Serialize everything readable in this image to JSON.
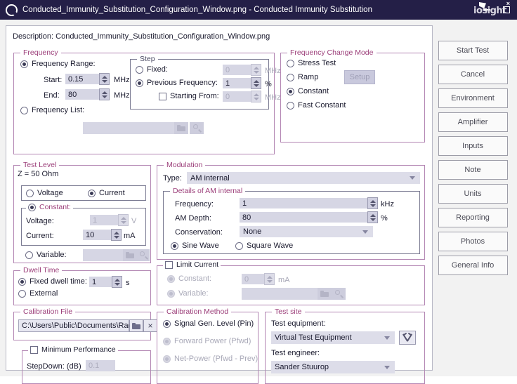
{
  "window": {
    "title": "Conducted_Immunity_Substitution_Configuration_Window.png - Conducted Immunity Substitution",
    "minimize_label": "–",
    "maximize_label": "□",
    "close_label": "×",
    "watermark": "iosight",
    "watermark_x": "x"
  },
  "description": "Description: Conducted_Immunity_Substitution_Configuration_Window.png",
  "frequency": {
    "legend": "Frequency",
    "range_radio": "Frequency Range:",
    "start_label": "Start:",
    "start_value": "0.15",
    "start_unit": "MHz",
    "end_label": "End:",
    "end_value": "80",
    "end_unit": "MHz",
    "list_radio": "Frequency List:",
    "list_value": "",
    "browse_icon": "folder-icon",
    "search_icon": "magnifier-icon",
    "step": {
      "legend": "Step",
      "fixed_radio": "Fixed:",
      "fixed_value": "0",
      "fixed_unit": "MHz",
      "previous_radio": "Previous Frequency:",
      "previous_value": "1",
      "previous_unit": "%",
      "starting_from_check": "Starting From:",
      "starting_from_value": "0",
      "starting_from_unit": "MHz"
    }
  },
  "frequency_change_mode": {
    "legend": "Frequency Change Mode",
    "options": [
      "Stress Test",
      "Ramp",
      "Constant",
      "Fast Constant"
    ],
    "selected": "Constant",
    "setup_button": "Setup"
  },
  "test_level": {
    "legend": "Test Level",
    "impedance": "Z = 50 Ohm",
    "voltage_radio": "Voltage",
    "current_radio": "Current",
    "mode_selected": "Current",
    "constant_radio": "Constant:",
    "voltage_label": "Voltage:",
    "voltage_value": "1",
    "voltage_unit": "V",
    "current_label": "Current:",
    "current_value": "10",
    "current_unit": "mA",
    "variable_radio": "Variable:",
    "variable_value": "",
    "browse_icon": "folder-icon",
    "search_icon": "magnifier-icon"
  },
  "modulation": {
    "legend": "Modulation",
    "type_label": "Type:",
    "type_value": "AM internal",
    "details_legend": "Details of AM internal",
    "frequency_label": "Frequency:",
    "frequency_value": "1",
    "frequency_unit": "kHz",
    "am_depth_label": "AM Depth:",
    "am_depth_value": "80",
    "am_depth_unit": "%",
    "conservation_label": "Conservation:",
    "conservation_value": "None",
    "sine_radio": "Sine Wave",
    "square_radio": "Square Wave",
    "wave_selected": "Sine Wave"
  },
  "dwell_time": {
    "legend": "Dwell Time",
    "fixed_radio": "Fixed dwell time:",
    "fixed_value": "1",
    "fixed_unit": "s",
    "external_radio": "External",
    "selected": "Fixed dwell time:"
  },
  "limit_current": {
    "legend": "Limit Current",
    "enabled": "false",
    "constant_radio": "Constant:",
    "constant_value": "0",
    "constant_unit": "mA",
    "variable_radio": "Variable:",
    "variable_value": "",
    "browse_icon": "folder-icon",
    "search_icon": "magnifier-icon"
  },
  "calibration_file": {
    "legend": "Calibration File",
    "path": "C:\\Users\\Public\\Documents\\RadiMatic",
    "browse_icon": "folder-icon",
    "clear_icon": "close-icon",
    "clear_label": "×"
  },
  "minimum_performance": {
    "legend": "Minimum Performance",
    "stepdown_label": "StepDown: (dB)",
    "stepdown_value": "0.1"
  },
  "calibration_method": {
    "legend": "Calibration Method",
    "options": [
      "Signal Gen. Level (Pin)",
      "Forward Power  (Pfwd)",
      "Net-Power (Pfwd - Prev)"
    ],
    "selected": "Signal Gen. Level (Pin)"
  },
  "test_site": {
    "legend": "Test site",
    "equipment_label": "Test equipment:",
    "equipment_value": "Virtual Test Equipment",
    "tools_icon": "tools-icon",
    "engineer_label": "Test engineer:",
    "engineer_value": "Sander Stuurop"
  },
  "side_buttons": [
    "Start Test",
    "Cancel",
    "Environment",
    "Amplifier",
    "Inputs",
    "Note",
    "Units",
    "Reporting",
    "Photos",
    "General Info"
  ]
}
